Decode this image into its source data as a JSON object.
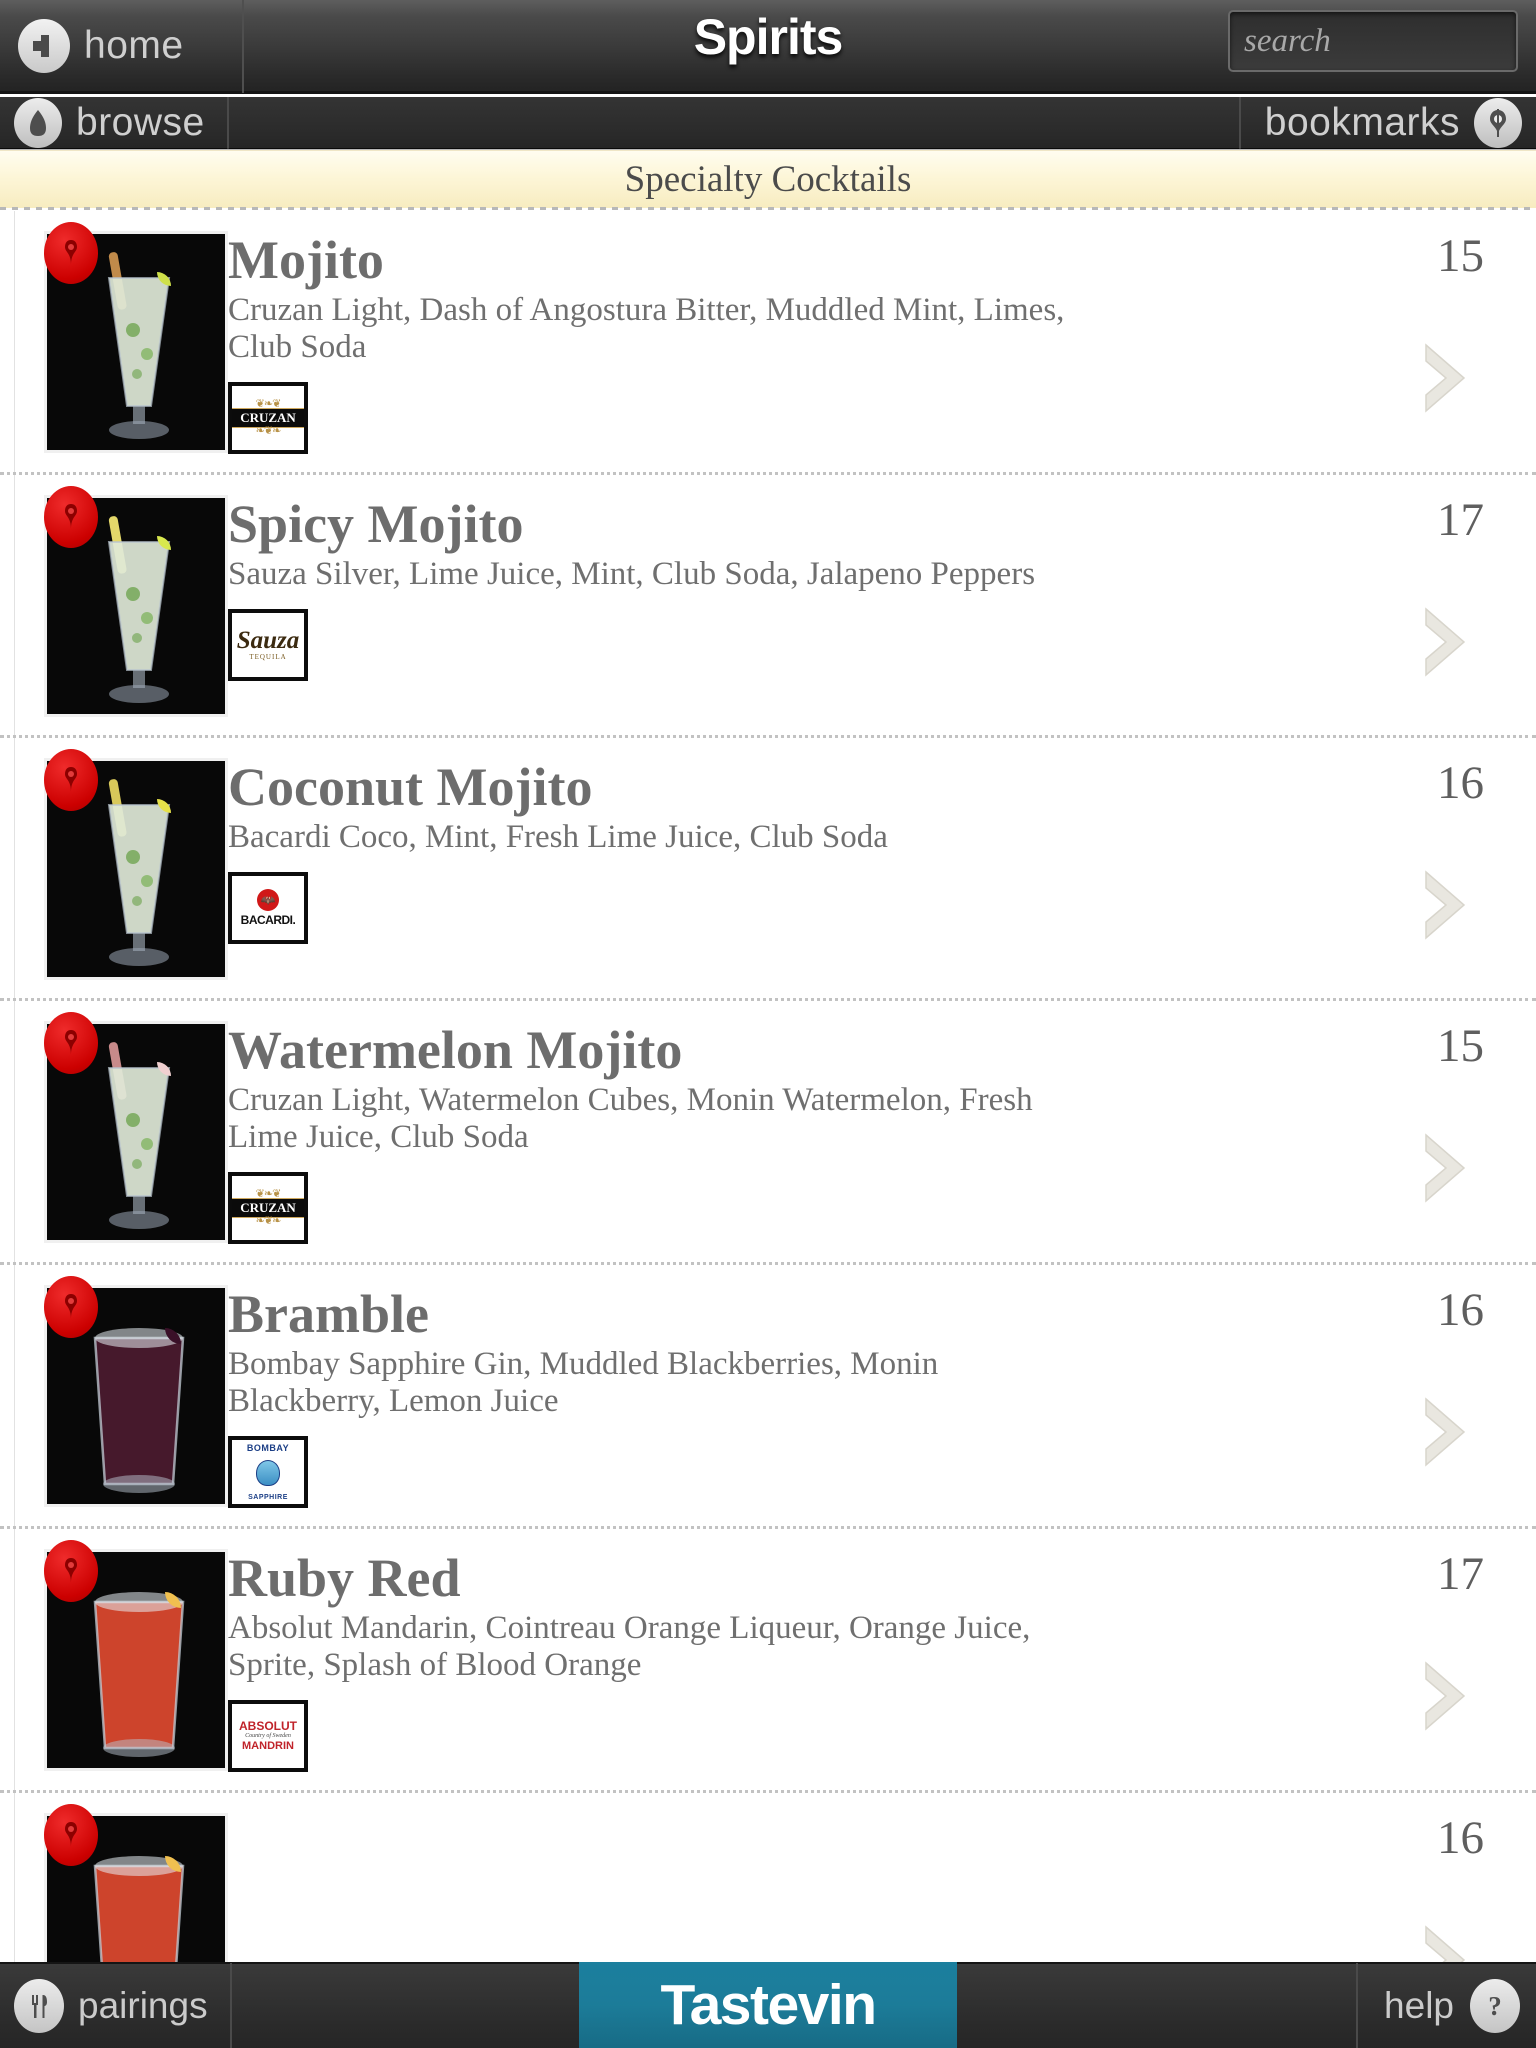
{
  "header": {
    "home_label": "home",
    "back_icon": "back-arrow-icon",
    "title": "Spirits",
    "search_placeholder": "search",
    "search_value": "",
    "search_icon": "search-icon"
  },
  "nav": {
    "browse_label": "browse",
    "browse_icon": "home-pentagon-icon",
    "bookmarks_label": "bookmarks",
    "bookmarks_icon": "corkscrew-icon"
  },
  "section": {
    "title": "Specialty Cocktails"
  },
  "colors": {
    "accent_teal": "#1c7c99",
    "badge_red": "#cc0000",
    "section_cream": "#fdf6d8",
    "bar_dark": "#2e2e2e",
    "text_gray": "#6f6f6f"
  },
  "items": [
    {
      "name": "Mojito",
      "description": "Cruzan Light, Dash of Angostura Bitter, Muddled Mint, Limes, Club Soda",
      "price": "15",
      "brand": "CRUZAN",
      "brand_logo": "cruzan-logo",
      "photo": "mojito-photo",
      "badge_icon": "bookmark-corkscrew-badge",
      "chevron_icon": "chevron-right-icon"
    },
    {
      "name": "Spicy Mojito",
      "description": "Sauza Silver, Lime Juice, Mint, Club Soda, Jalapeno Peppers",
      "price": "17",
      "brand": "Sauza",
      "brand_logo": "sauza-logo",
      "photo": "spicy-mojito-photo",
      "badge_icon": "bookmark-corkscrew-badge",
      "chevron_icon": "chevron-right-icon"
    },
    {
      "name": "Coconut Mojito",
      "description": "Bacardi Coco, Mint, Fresh Lime Juice, Club Soda",
      "price": "16",
      "brand": "BACARDI",
      "brand_logo": "bacardi-logo",
      "photo": "coconut-mojito-photo",
      "badge_icon": "bookmark-corkscrew-badge",
      "chevron_icon": "chevron-right-icon"
    },
    {
      "name": "Watermelon Mojito",
      "description": "Cruzan Light, Watermelon Cubes, Monin Watermelon, Fresh Lime Juice, Club Soda",
      "price": "15",
      "brand": "CRUZAN",
      "brand_logo": "cruzan-logo",
      "photo": "watermelon-mojito-photo",
      "badge_icon": "bookmark-corkscrew-badge",
      "chevron_icon": "chevron-right-icon"
    },
    {
      "name": "Bramble",
      "description": "Bombay Sapphire Gin, Muddled Blackberries, Monin Blackberry, Lemon Juice",
      "price": "16",
      "brand": "BOMBAY SAPPHIRE",
      "brand_logo": "bombay-sapphire-logo",
      "photo": "bramble-photo",
      "badge_icon": "bookmark-corkscrew-badge",
      "chevron_icon": "chevron-right-icon"
    },
    {
      "name": "Ruby Red",
      "description": "Absolut Mandarin, Cointreau Orange Liqueur, Orange Juice, Sprite, Splash of Blood Orange",
      "price": "17",
      "brand": "ABSOLUT MANDRIN",
      "brand_logo": "absolut-mandrin-logo",
      "photo": "ruby-red-photo",
      "badge_icon": "bookmark-corkscrew-badge",
      "chevron_icon": "chevron-right-icon"
    },
    {
      "name": "",
      "description": "",
      "price": "16",
      "brand": "",
      "brand_logo": "",
      "photo": "next-item-photo",
      "badge_icon": "bookmark-corkscrew-badge",
      "chevron_icon": "chevron-right-icon"
    }
  ],
  "footer": {
    "pairings_label": "pairings",
    "pairings_icon": "fork-knife-icon",
    "brand_label": "Tastevin",
    "help_label": "help",
    "help_icon": "question-mark-icon"
  }
}
